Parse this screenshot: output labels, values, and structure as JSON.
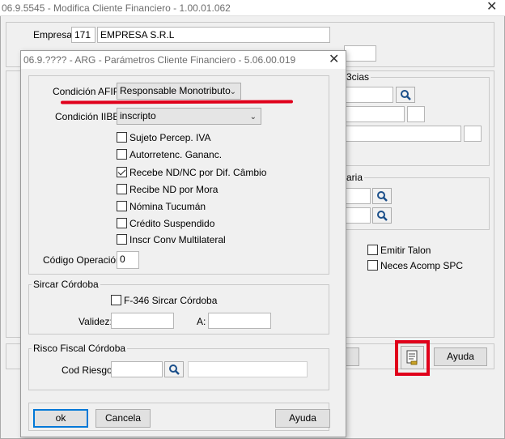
{
  "main_window": {
    "title": "06.9.5545 - Modifica Cliente Financiero - 1.00.01.062",
    "empresa_label": "Empresa:",
    "empresa_code": "171",
    "empresa_name": "EMPRESA  S.R.L",
    "bcias_group_title": "3cias",
    "aria_group_title": "aria",
    "checkboxes": [
      {
        "label": "Emitir Talon",
        "checked": false
      },
      {
        "label": "Neces Acomp SPC",
        "checked": false
      }
    ],
    "help_button": "Ayuda",
    "doc_icon": "document-icon"
  },
  "dialog": {
    "title": "06.9.???? - ARG - Parámetros Cliente Financiero - 5.06.00.019",
    "condicion_afip_label": "Condición AFIP:",
    "condicion_afip_value": "Responsable Monotributo",
    "condicion_iibb_label": "Condición IIBB:",
    "condicion_iibb_value": "inscripto",
    "checkboxes": [
      {
        "label": "Sujeto Percep. IVA",
        "checked": false
      },
      {
        "label": "Autorretenc. Gananc.",
        "checked": false
      },
      {
        "label": "Recebe ND/NC por Dif. Câmbio",
        "checked": true
      },
      {
        "label": "Recibe ND por Mora",
        "checked": false
      },
      {
        "label": "Nómina Tucumán",
        "checked": false
      },
      {
        "label": "Crédito Suspendido",
        "checked": false
      },
      {
        "label": "Inscr Conv Multilateral",
        "checked": false
      }
    ],
    "codigo_operacion_label": "Código Operación:",
    "codigo_operacion_value": "0",
    "sircar_group_title": "Sircar Córdoba",
    "f346_label": "F-346 Sircar Córdoba",
    "f346_checked": false,
    "validez_label": "Validez:",
    "validez_value": "",
    "a_label": "A:",
    "a_value": "",
    "risco_group_title": "Risco Fiscal Córdoba",
    "cod_riesgo_label": "Cod Riesgo:",
    "cod_riesgo_value": "",
    "cod_riesgo_desc": "",
    "ok_button": "ok",
    "cancel_button": "Cancela",
    "help_button": "Ayuda"
  },
  "colors": {
    "dialog_bg": "#f0f0f0",
    "highlight_red": "#e0001b",
    "accent_blue": "#0078d7"
  }
}
